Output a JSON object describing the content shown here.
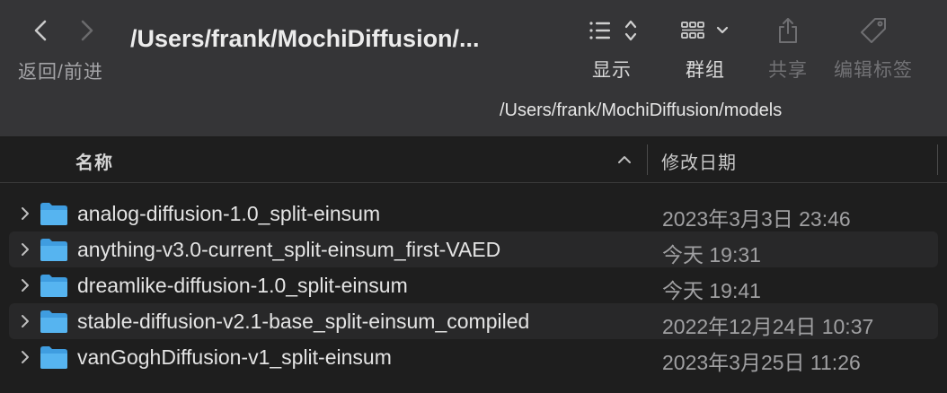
{
  "toolbar": {
    "nav_label": "返回/前进",
    "title": "/Users/frank/MochiDiffusion/...",
    "tools": [
      {
        "label": "显示",
        "icon": "list-view-icon",
        "enabled": true
      },
      {
        "label": "群组",
        "icon": "group-grid-icon",
        "enabled": true
      },
      {
        "label": "共享",
        "icon": "share-icon",
        "enabled": false
      },
      {
        "label": "编辑标签",
        "icon": "tag-icon",
        "enabled": false
      }
    ]
  },
  "path_tooltip": "/Users/frank/MochiDiffusion/models",
  "columns": {
    "name": "名称",
    "date_modified": "修改日期"
  },
  "files": [
    {
      "name": "analog-diffusion-1.0_split-einsum",
      "date": "2023年3月3日 23:46"
    },
    {
      "name": "anything-v3.0-current_split-einsum_first-VAED",
      "date": "今天 19:31"
    },
    {
      "name": "dreamlike-diffusion-1.0_split-einsum",
      "date": "今天 19:41"
    },
    {
      "name": "stable-diffusion-v2.1-base_split-einsum_compiled",
      "date": "2022年12月24日 10:37"
    },
    {
      "name": "vanGoghDiffusion-v1_split-einsum",
      "date": "2023年3月25日 11:26"
    }
  ],
  "colors": {
    "toolbar_bg": "#353537",
    "list_bg": "#1e1e1e",
    "folder_blue": "#56b4f0"
  }
}
